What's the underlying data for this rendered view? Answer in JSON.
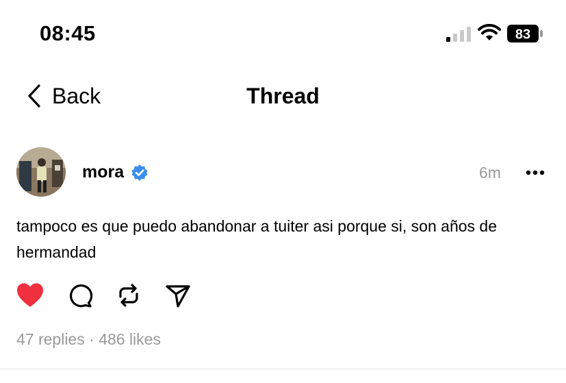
{
  "status_bar": {
    "time": "08:45",
    "battery": "83",
    "icons": [
      "cellular-signal-icon",
      "wifi-icon",
      "battery-icon"
    ]
  },
  "nav": {
    "back_label": "Back",
    "title": "Thread",
    "back_icon": "chevron-left-icon"
  },
  "post": {
    "username": "mora",
    "verified": true,
    "time_ago": "6m",
    "text": "tampoco es que puedo abandonar a tuiter asi porque si, son años de hermandad",
    "liked": true,
    "actions": [
      "like-icon",
      "reply-icon",
      "repost-icon",
      "share-icon"
    ],
    "stats": {
      "replies": "47 replies",
      "separator": "·",
      "likes": "486 likes"
    }
  },
  "colors": {
    "like": "#f0303f",
    "verified": "#3a8ef0",
    "muted": "#999999"
  }
}
